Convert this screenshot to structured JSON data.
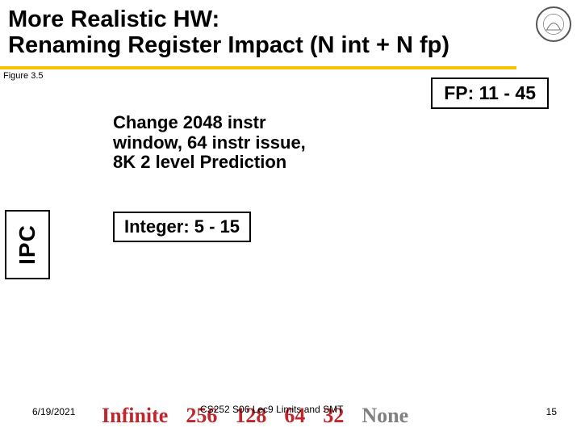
{
  "title_line1": "More Realistic HW:",
  "title_line2": "Renaming Register Impact (N int + N fp)",
  "figure_caption": "Figure 3.5",
  "fp_box": "FP: 11 - 45",
  "change_text": "Change  2048 instr window, 64 instr issue, 8K 2 level Prediction",
  "ipc_label": "IPC",
  "integer_box": "Integer: 5 - 15",
  "footer": {
    "date": "6/19/2021",
    "course": "CS252 S06 Lec9 Limits and SMT",
    "page": "15"
  },
  "x_categories": [
    "Infinite",
    "256",
    "128",
    "64",
    "32",
    "None"
  ]
}
